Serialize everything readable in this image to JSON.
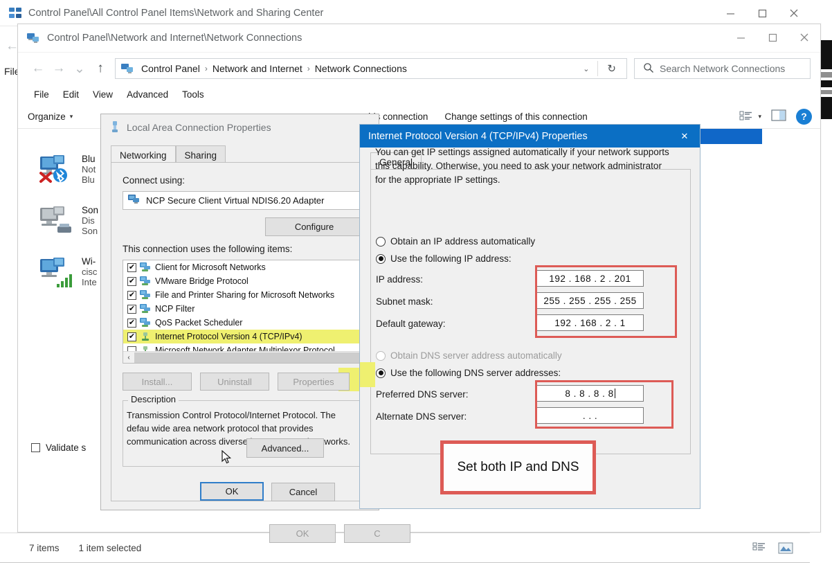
{
  "back_window": {
    "title": "Control Panel\\All Control Panel Items\\Network and Sharing Center",
    "left_menu_file": "File",
    "status": {
      "items": "7 items",
      "selected": "1 item selected"
    },
    "window_controls": {
      "minimize": "–",
      "maximize": "□",
      "close": "✕"
    }
  },
  "explorer": {
    "title": "Control Panel\\Network and Internet\\Network Connections",
    "window_controls": {
      "minimize": "–",
      "maximize": "□",
      "close": "✕"
    },
    "nav": {
      "back": "←",
      "forward": "→",
      "recent": "⌄",
      "up": "↑"
    },
    "breadcrumbs": [
      "Control Panel",
      "Network and Internet",
      "Network Connections"
    ],
    "breadcrumb_separator": "›",
    "address_chevron": "⌄",
    "refresh": "↻",
    "search": {
      "placeholder": "Search Network Connections",
      "icon": "search-icon"
    },
    "menu": [
      "File",
      "Edit",
      "View",
      "Advanced",
      "Tools"
    ],
    "command_bar": {
      "organize": "Organize",
      "organize_caret": "▾",
      "rename_link": "ename this connection",
      "change_settings_link": "Change settings of this connection",
      "view_caret": "▾",
      "help": "?"
    },
    "adapters": [
      {
        "name": "Blu",
        "line2": "Not",
        "line3": "Blu",
        "icon": "bluetooth-network-icon"
      },
      {
        "name": "Son",
        "line2": "Dis",
        "line3": "Son",
        "icon": "modem-network-icon"
      },
      {
        "name": "Wi-",
        "line2": "cisc",
        "line3": "Inte",
        "icon": "wifi-network-icon"
      }
    ]
  },
  "lan_dialog": {
    "title": "Local Area Connection Properties",
    "tabs": [
      {
        "label": "Networking",
        "active": true
      },
      {
        "label": "Sharing",
        "active": false
      }
    ],
    "connect_using_label": "Connect using:",
    "adapter_name": "NCP Secure Client Virtual NDIS6.20 Adapter",
    "configure_button": "Configure",
    "items_label": "This connection uses the following items:",
    "items": [
      {
        "label": "Client for Microsoft Networks",
        "checked": true,
        "highlighted": false
      },
      {
        "label": "VMware Bridge Protocol",
        "checked": true,
        "highlighted": false
      },
      {
        "label": "File and Printer Sharing for Microsoft Networks",
        "checked": true,
        "highlighted": false
      },
      {
        "label": "NCP Filter",
        "checked": true,
        "highlighted": false
      },
      {
        "label": "QoS Packet Scheduler",
        "checked": true,
        "highlighted": false
      },
      {
        "label": "Internet Protocol Version 4 (TCP/IPv4)",
        "checked": true,
        "highlighted": true
      },
      {
        "label": "Microsoft Network Adapter Multiplexor Protocol",
        "checked": false,
        "highlighted": false
      }
    ],
    "scroll_left_arrow": "‹",
    "buttons": {
      "install": "Install...",
      "uninstall": "Uninstall",
      "properties": "Properties",
      "ok": "OK",
      "cancel": "C"
    },
    "description_legend": "Description",
    "description_text": "Transmission Control Protocol/Internet Protocol. The defau wide area network protocol that provides communication across diverse interconnected networks."
  },
  "ipv4_dialog": {
    "title": "Internet Protocol Version 4 (TCP/IPv4) Properties",
    "close": "✕",
    "tabs": [
      {
        "label": "General",
        "active": true
      }
    ],
    "intro_text": "You can get IP settings assigned automatically if your network supports this capability. Otherwise, you need to ask your network administrator for the appropriate IP settings.",
    "ip_mode": {
      "auto_label": "Obtain an IP address automatically",
      "manual_label": "Use the following IP address:",
      "selected": "manual"
    },
    "fields": {
      "ip_address_label": "IP address:",
      "ip_address_value": "192 . 168 .  2  . 201",
      "subnet_mask_label": "Subnet mask:",
      "subnet_mask_value": "255 . 255 . 255 . 255",
      "default_gateway_label": "Default gateway:",
      "default_gateway_value": "192 . 168 .  2  .  1"
    },
    "dns_mode": {
      "auto_label": "Obtain DNS server address automatically",
      "manual_label": "Use the following DNS server addresses:",
      "selected": "manual"
    },
    "dns_fields": {
      "preferred_label": "Preferred DNS server:",
      "preferred_value": "8 . 8 . 8 . 8",
      "alternate_label": "Alternate DNS server:",
      "alternate_value": ".   .   ."
    },
    "validate_label": "Validate s",
    "advanced_button": "Advanced...",
    "ok_button": "OK",
    "cancel_button": "Cancel"
  },
  "annotation": {
    "text": "Set both IP and DNS",
    "border_color": "#dd5b56"
  },
  "colors": {
    "title_bar_blue": "#0b6fc4",
    "selection_blue": "#1067c8",
    "highlight_yellow": "#eff070",
    "annotation_red": "#dd5b56",
    "dialog_face": "#f0f0f0"
  }
}
